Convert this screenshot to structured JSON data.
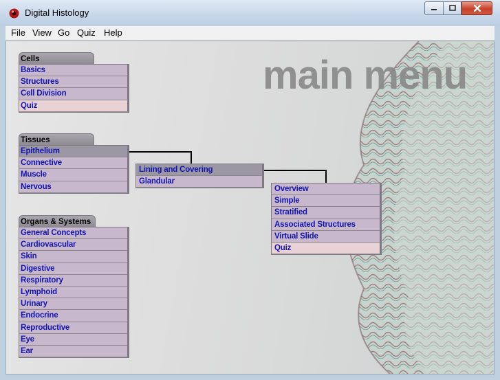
{
  "window": {
    "title": "Digital Histology",
    "icon": "red-cell-icon"
  },
  "menubar": [
    "File",
    "View",
    "Go",
    "Quiz",
    "Help"
  ],
  "header": {
    "title": "main menu"
  },
  "cells": {
    "tab_label": "Cells",
    "items": [
      "Basics",
      "Structures",
      "Cell Division",
      "Quiz"
    ]
  },
  "tissues": {
    "tab_label": "Tissues",
    "items": [
      "Epithelium",
      "Connective",
      "Muscle",
      "Nervous"
    ]
  },
  "organs": {
    "tab_label": "Organs & Systems",
    "items": [
      "General Concepts",
      "Cardiovascular",
      "Skin",
      "Digestive",
      "Respiratory",
      "Lymphoid",
      "Urinary",
      "Endocrine",
      "Reproductive",
      "Eye",
      "Ear"
    ]
  },
  "epithelium_submenu": {
    "items": [
      "Lining and Covering",
      "Glandular"
    ]
  },
  "lining_submenu": {
    "items": [
      "Overview",
      "Simple",
      "Stratified",
      "Associated Structures",
      "Virtual Slide",
      "Quiz"
    ]
  },
  "colors": {
    "item_bg": "#c8b8cc",
    "item_text": "#1414b0",
    "quiz_bg": "#e8d2d6",
    "selected_bg": "#9c98a3"
  }
}
